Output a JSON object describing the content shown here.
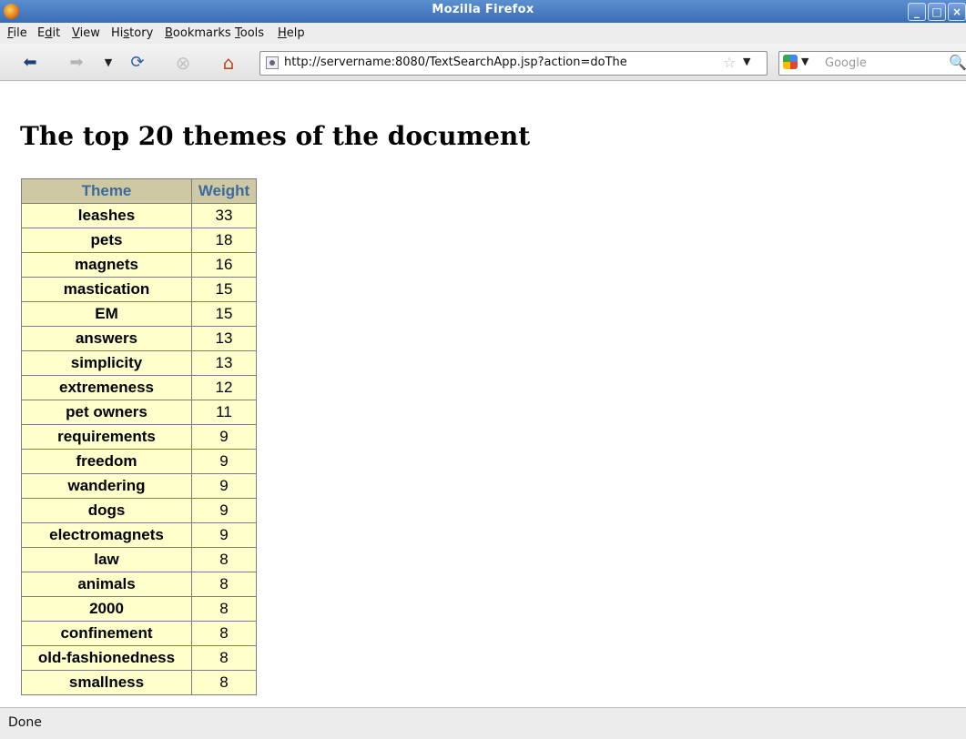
{
  "window": {
    "title": "Mozilla Firefox"
  },
  "menu": [
    "File",
    "Edit",
    "View",
    "History",
    "Bookmarks",
    "Tools",
    "Help"
  ],
  "menu_mnemonic_index": [
    0,
    1,
    0,
    2,
    0,
    0,
    0
  ],
  "nav": {
    "url": "http://servername:8080/TextSearchApp.jsp?action=doThe",
    "search_placeholder": "Google"
  },
  "page": {
    "heading": "The top 20 themes of the document",
    "table": {
      "headers": [
        "Theme",
        "Weight"
      ],
      "rows": [
        [
          "leashes",
          "33"
        ],
        [
          "pets",
          "18"
        ],
        [
          "magnets",
          "16"
        ],
        [
          "mastication",
          "15"
        ],
        [
          "EM",
          "15"
        ],
        [
          "answers",
          "13"
        ],
        [
          "simplicity",
          "13"
        ],
        [
          "extremeness",
          "12"
        ],
        [
          "pet owners",
          "11"
        ],
        [
          "requirements",
          "9"
        ],
        [
          "freedom",
          "9"
        ],
        [
          "wandering",
          "9"
        ],
        [
          "dogs",
          "9"
        ],
        [
          "electromagnets",
          "9"
        ],
        [
          "law",
          "8"
        ],
        [
          "animals",
          "8"
        ],
        [
          "2000",
          "8"
        ],
        [
          "confinement",
          "8"
        ],
        [
          "old-fashionedness",
          "8"
        ],
        [
          "smallness",
          "8"
        ]
      ]
    }
  },
  "status": {
    "text": "Done"
  }
}
